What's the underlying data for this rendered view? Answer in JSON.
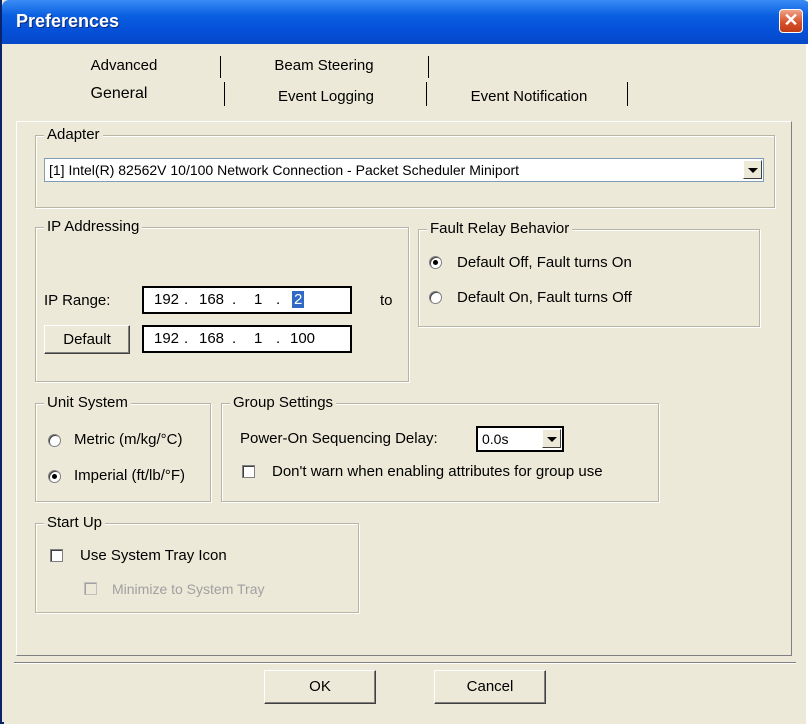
{
  "window": {
    "title": "Preferences",
    "close_glyph": "✕"
  },
  "tabs": {
    "row1": [
      "Advanced",
      "Beam Steering"
    ],
    "row2": [
      "General",
      "Event Logging",
      "Event Notification"
    ],
    "active": "General"
  },
  "adapter": {
    "label": "Adapter",
    "selected": "[1] Intel(R) 82562V 10/100 Network Connection - Packet Scheduler Miniport"
  },
  "ip": {
    "label": "IP Addressing",
    "range_label": "IP Range:",
    "to_label": "to",
    "start": [
      "192",
      ".",
      "168",
      ".",
      "1",
      ".",
      "2"
    ],
    "end": [
      "192",
      ".",
      "168",
      ".",
      "1",
      ".",
      "100"
    ],
    "default_button": "Default"
  },
  "fault": {
    "label": "Fault Relay Behavior",
    "options": [
      "Default Off, Fault turns On",
      "Default On, Fault turns Off"
    ],
    "selected_index": 0
  },
  "units": {
    "label": "Unit System",
    "options": [
      "Metric (m/kg/°C)",
      "Imperial (ft/lb/°F)"
    ],
    "selected_index": 1
  },
  "group": {
    "label": "Group Settings",
    "delay_label": "Power-On Sequencing Delay:",
    "delay_value": "0.0s",
    "warn_label": "Don't warn when enabling attributes for group use",
    "warn_checked": false
  },
  "startup": {
    "label": "Start Up",
    "tray_label": "Use System Tray Icon",
    "minimize_label": "Minimize to System Tray"
  },
  "buttons": {
    "ok": "OK",
    "cancel": "Cancel"
  }
}
